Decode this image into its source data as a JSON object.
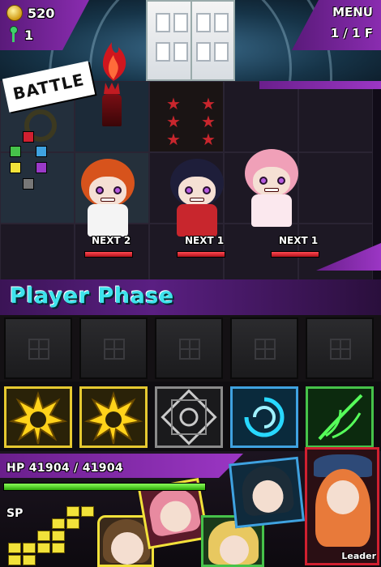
{
  "hud": {
    "gold": "520",
    "keys": "1",
    "menu_label": "MENU",
    "floor_label": "1 / 1 F"
  },
  "battle": {
    "tag": "BATTLE",
    "enemies": [
      {
        "next_label": "NEXT 2",
        "hp_fraction": 1.0,
        "hair": "#d7531c",
        "outfit": "#f4f4f4"
      },
      {
        "next_label": "NEXT 1",
        "hp_fraction": 1.0,
        "hair": "#1e1e3a",
        "outfit": "#c8262d"
      },
      {
        "next_label": "NEXT 1",
        "hp_fraction": 1.0,
        "hair": "#f0a0b8",
        "outfit": "#fbe8ee"
      }
    ]
  },
  "phase": {
    "label": "Player Phase"
  },
  "skills": [
    {
      "name": "light-skill",
      "border": "#e6c930",
      "glow": "#ffd21a"
    },
    {
      "name": "light-skill",
      "border": "#e6c930",
      "glow": "#ffd21a"
    },
    {
      "name": "dark-skill",
      "border": "#8a8a8a",
      "glow": "#c9c9c9"
    },
    {
      "name": "water-skill",
      "border": "#3fa2e0",
      "glow": "#28d8ff"
    },
    {
      "name": "wood-skill",
      "border": "#46c24a",
      "glow": "#56ff5a"
    }
  ],
  "party": {
    "hp_label": "HP 41904 / 41904",
    "hp_fraction": 1.0,
    "sp_label": "SP",
    "leader_label": "Leader",
    "members": [
      {
        "name": "member-glasses",
        "border": "#f2e23a",
        "hair": "#6a4a2a"
      },
      {
        "name": "member-pink",
        "border": "#f2e23a",
        "hair": "#e88aa0"
      },
      {
        "name": "member-blonde",
        "border": "#46c24a",
        "hair": "#e8c860"
      },
      {
        "name": "member-dark",
        "border": "#3fa2e0",
        "hair": "#1c2c38"
      },
      {
        "name": "member-leader",
        "border": "#d02030",
        "hair": "#e87a3a"
      }
    ]
  },
  "colors": {
    "accent_purple": "#7a2aa8",
    "phase_cyan": "#3ee3ec",
    "hp_green": "#5ee02a",
    "enemy_hp_red": "#e0262f"
  }
}
